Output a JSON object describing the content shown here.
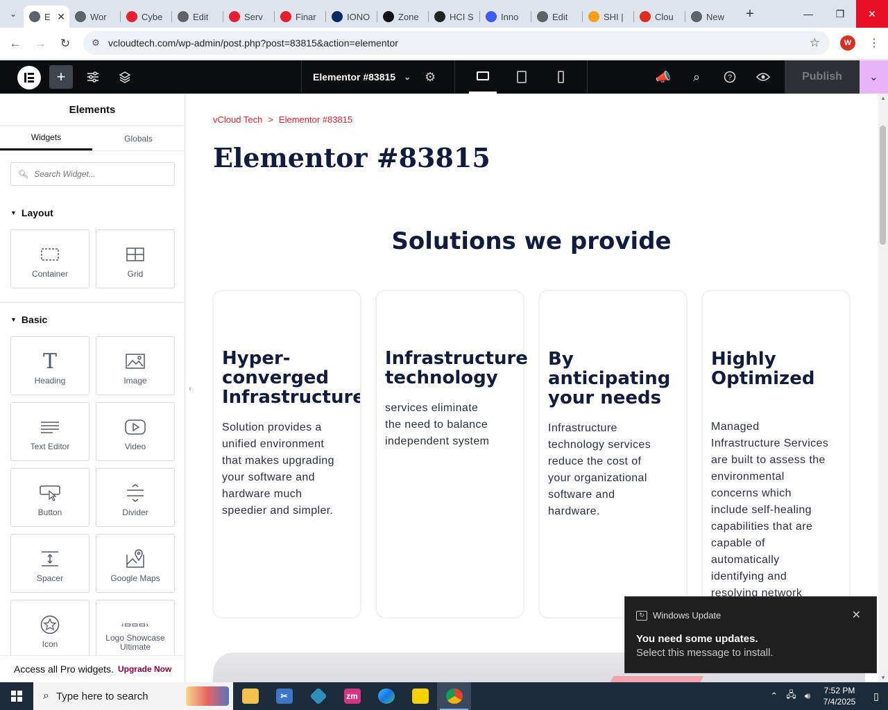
{
  "browser": {
    "tabs": [
      {
        "label": "E",
        "favicon": "elementor",
        "color": "#5f6368",
        "active": true
      },
      {
        "label": "Wor",
        "favicon": "wordpress",
        "color": "#5f6368"
      },
      {
        "label": "Cybe",
        "favicon": "hubspot-form",
        "color": "#e2202f"
      },
      {
        "label": "Edit",
        "favicon": "wordpress",
        "color": "#5f6368"
      },
      {
        "label": "Serv",
        "favicon": "hubspot-form",
        "color": "#e2202f"
      },
      {
        "label": "Finar",
        "favicon": "hubspot-form",
        "color": "#e2202f"
      },
      {
        "label": "IONO",
        "favicon": "ionos",
        "color": "#0b2a63"
      },
      {
        "label": "Zone",
        "favicon": "zone",
        "color": "#111111"
      },
      {
        "label": "HCI S",
        "favicon": "hci",
        "color": "#222222"
      },
      {
        "label": "Inno",
        "favicon": "innovation",
        "color": "#3d5af1"
      },
      {
        "label": "Edit",
        "favicon": "wordpress",
        "color": "#5f6368"
      },
      {
        "label": "SHI |",
        "favicon": "shi",
        "color": "#f6a01a"
      },
      {
        "label": "Clou",
        "favicon": "cloud",
        "color": "#d93025"
      },
      {
        "label": "New",
        "favicon": "chrome",
        "color": "#5f6368"
      }
    ],
    "url": "vcloudtech.com/wp-admin/post.php?post=83815&action=elementor",
    "profile_initial": "W"
  },
  "editor": {
    "doc_title": "Elementor #83815",
    "publish_label": "Publish"
  },
  "sidebar": {
    "title": "Elements",
    "tabs": [
      "Widgets",
      "Globals"
    ],
    "search_placeholder": "Search Widget...",
    "layout_label": "Layout",
    "basic_label": "Basic",
    "layout_widgets": [
      {
        "label": "Container",
        "icon": "container-icon"
      },
      {
        "label": "Grid",
        "icon": "grid-icon"
      }
    ],
    "basic_widgets": [
      {
        "label": "Heading",
        "icon": "heading-icon"
      },
      {
        "label": "Image",
        "icon": "image-icon"
      },
      {
        "label": "Text Editor",
        "icon": "text-editor-icon"
      },
      {
        "label": "Video",
        "icon": "video-icon"
      },
      {
        "label": "Button",
        "icon": "button-icon"
      },
      {
        "label": "Divider",
        "icon": "divider-icon"
      },
      {
        "label": "Spacer",
        "icon": "spacer-icon"
      },
      {
        "label": "Google Maps",
        "icon": "google-maps-icon"
      },
      {
        "label": "Icon",
        "icon": "star-icon"
      },
      {
        "label": "Logo Showcase Ultimate",
        "icon": "logo-showcase-icon"
      }
    ],
    "pro_text": "Access all Pro widgets.",
    "upgrade_label": "Upgrade Now"
  },
  "canvas": {
    "breadcrumb_home": "vCloud Tech",
    "breadcrumb_sep": ">",
    "breadcrumb_current": "Elementor #83815",
    "page_title": "Elementor #83815",
    "section_title": "Solutions we provide",
    "cards": [
      {
        "title": "Hyper-\nconverged\nInfrastructure",
        "text": "Solution provides a\nunified environment\nthat makes upgrading\nyour software and\nhardware much\nspeedier and simpler."
      },
      {
        "title": "Infrastructure\ntechnology",
        "text": "services eliminate\nthe need to balance\nindependent system"
      },
      {
        "title": "By\nanticipating\nyour needs",
        "text": "Infrastructure\ntechnology services\nreduce the cost of\nyour organizational\nsoftware and\nhardware."
      },
      {
        "title": "Highly\nOptimized",
        "text": "Managed\nInfrastructure Services\nare built to assess the\nenvironmental\nconcerns which\ninclude self-healing\ncapabilities that are\ncapable of\nautomatically\nidentifying and\nresolving network"
      }
    ]
  },
  "toast": {
    "app": "Windows Update",
    "title": "You need some updates.",
    "message": "Select this message to install."
  },
  "taskbar": {
    "search_placeholder": "Type here to search",
    "time": "7:52 PM",
    "date": "7/4/2025"
  }
}
